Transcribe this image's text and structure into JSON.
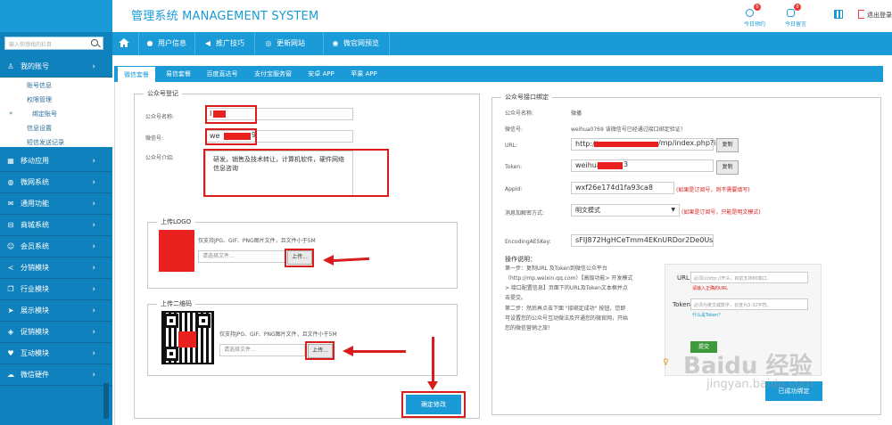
{
  "header": {
    "title": "管理系统 MANAGEMENT SYSTEM",
    "today_reservation_label": "今日预约",
    "today_reservation_count": "0",
    "today_message_label": "今日留言",
    "today_message_count": "0",
    "logout_label": "退出登录"
  },
  "topnav": {
    "items": [
      {
        "label": "用户信息",
        "icon": "user-icon"
      },
      {
        "label": "推广技巧",
        "icon": "megaphone-icon"
      },
      {
        "label": "更新网站",
        "icon": "refresh-icon"
      },
      {
        "label": "微官网预览",
        "icon": "eye-icon"
      }
    ]
  },
  "sidebar": {
    "search_placeholder": "输入你想找的栏目",
    "menus": [
      {
        "label": "我的账号",
        "icon": "user-icon"
      },
      {
        "label": "移动应用",
        "icon": "grid-icon"
      },
      {
        "label": "微网系统",
        "icon": "globe-icon"
      },
      {
        "label": "通用功能",
        "icon": "mail-icon"
      },
      {
        "label": "商城系统",
        "icon": "cart-icon"
      },
      {
        "label": "会员系统",
        "icon": "member-icon"
      },
      {
        "label": "分销模块",
        "icon": "share-icon"
      },
      {
        "label": "行业模块",
        "icon": "copy-icon"
      },
      {
        "label": "展示模块",
        "icon": "send-icon"
      },
      {
        "label": "促销模块",
        "icon": "tag-icon"
      },
      {
        "label": "互动模块",
        "icon": "heart-icon"
      },
      {
        "label": "微信硬件",
        "icon": "cloud-icon"
      }
    ],
    "subitems": [
      "账号信息",
      "权限管理",
      "绑定账号",
      "信息设置",
      "短信发送记录"
    ]
  },
  "tabs": [
    "微信套餐",
    "易信套餐",
    "百度直达号",
    "支付宝服务窗",
    "安卓 APP",
    "苹果 APP"
  ],
  "left": {
    "register_legend": "公众号登记",
    "name_label": "公众号名称:",
    "name_value": "I",
    "wechat_label": "微信号:",
    "wechat_value": "we",
    "wechat_value_tail": "9",
    "intro_label": "公众号介绍:",
    "intro_value": "研发，销售及技术转让，计算机软件，硬件网络信息咨询",
    "logo_legend": "上传LOGO",
    "logo_hint": "仅支持JPG、GIF、PNG图片文件，且文件小于5M",
    "logo_file_placeholder": "请选择文件...",
    "logo_upload_btn": "上传...",
    "qr_legend": "上传二维码",
    "qr_hint": "仅支持JPG、GIF、PNG图片文件，且文件小于5M",
    "qr_file_placeholder": "请选择文件...",
    "qr_upload_btn": "上传...",
    "submit_btn": "确定修改"
  },
  "right": {
    "legend": "公众号接口绑定",
    "name_label": "公众号名称:",
    "name_value": "微播",
    "wechat_label": "微信号:",
    "wechat_value": "weihua0769 该微信号已经通过接口绑定验证！",
    "url_label": "URL:",
    "url_value_prefix": "http://",
    "url_value_suffix": "/mp/index.php?i",
    "copy_btn": "复制",
    "token_label": "Token:",
    "token_value": "weihua",
    "token_value_tail": "3",
    "appid_label": "AppId:",
    "appid_value": "wxf26e174d1fa93ca8",
    "appid_note": "(如果是订阅号，则不需要填写)",
    "mode_label": "消息加解密方式:",
    "mode_value": "明文模式",
    "mode_note": "(如果是订阅号，只能是明文模式)",
    "aes_label": "EncodingAESKey:",
    "aes_value": "sFIJ872HgHCeTmm4EKnURDor2De0UsNr1l",
    "instr_title": "操作说明：",
    "instr_lines": [
      "第一步：复制URL 及Token到微信公众平台",
      "（http://mp.weixin.qq.com）【高级功能> 开发模式",
      "> 接口配置信息】页面下的URL及Token文本框并点",
      "击提交。",
      "第二步：然后再点击下面 \"接绑定成功\" 按钮，您即",
      "可设置您的公众号互动微法及开通您的微官网，开始",
      "您的微信营销之旅！"
    ],
    "mini_url_label": "URL",
    "mini_url_placeholder": "必须以http://开头，目前支持80端口。",
    "mini_url_hint": "请输入正确的URL",
    "mini_token_label": "Token",
    "mini_token_placeholder": "必须为英文或数字，长度为3-32字符。",
    "mini_token_hint": "什么是Token？",
    "mini_submit": "提交",
    "bind_btn": "已成功绑定"
  },
  "watermark": {
    "line1": "Baidu 经验",
    "line2": "jingyan.baidu.com"
  },
  "colors": {
    "brand": "#1a9ad6",
    "sidebar": "#0f82bd",
    "alert": "#d91c1c"
  }
}
